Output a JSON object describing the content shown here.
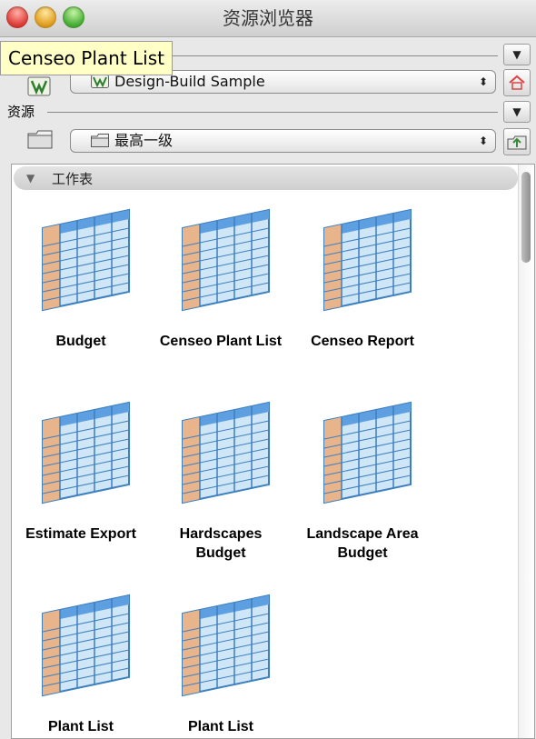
{
  "window": {
    "title": "资源浏览器"
  },
  "tooltip": {
    "text": "Censeo Plant List"
  },
  "file_popup": {
    "value": "Design-Build Sample"
  },
  "resources": {
    "label": "资源",
    "popup_value": "最高一级"
  },
  "group": {
    "label": "工作表"
  },
  "items": [
    {
      "label": "Budget"
    },
    {
      "label": "Censeo Plant List"
    },
    {
      "label": "Censeo Report"
    },
    {
      "label": "Estimate Export"
    },
    {
      "label": "Hardscapes Budget"
    },
    {
      "label": "Landscape Area Budget"
    },
    {
      "label": "Plant List"
    },
    {
      "label": "Plant List"
    }
  ],
  "icons": {
    "menu_triangle": "triangle-down",
    "home": "home-icon",
    "folder": "folder-icon",
    "spreadsheet": "spreadsheet-icon"
  }
}
